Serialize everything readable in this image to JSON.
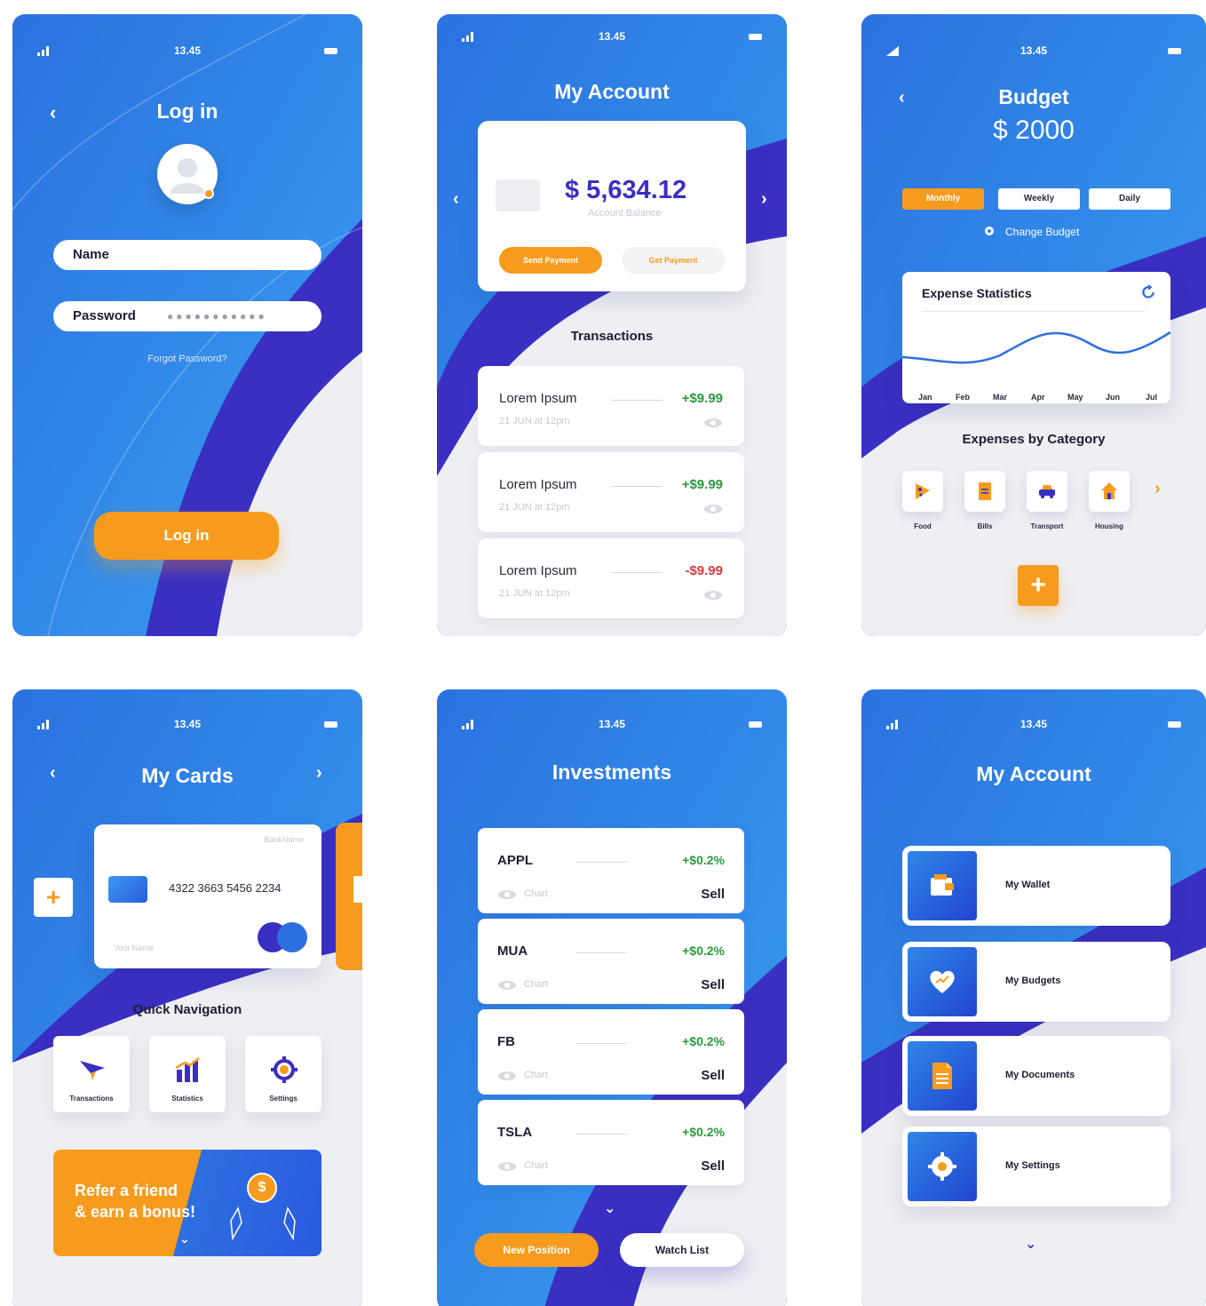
{
  "status": {
    "time": "13.45"
  },
  "colors": {
    "blue": "#2a7de6",
    "navy": "#3a2fc2",
    "orange": "#f79b1e",
    "green": "#2a9a3a",
    "red": "#d83a3a"
  },
  "login": {
    "title": "Log in",
    "name_label": "Name",
    "password_label": "Password",
    "password_mask": "●●●●●●●●●●●",
    "forgot": "Forgot Password?",
    "button": "Log in"
  },
  "account": {
    "title": "My Account",
    "balance": "$ 5,634.12",
    "balance_label": "Account Balance",
    "send": "Send Payment",
    "get": "Get Payment",
    "transactions_title": "Transactions",
    "transactions": [
      {
        "name": "Lorem Ipsum",
        "date": "21 JUN at 12pm",
        "amount": "+$9.99",
        "sign": "pos"
      },
      {
        "name": "Lorem Ipsum",
        "date": "21 JUN at 12pm",
        "amount": "+$9.99",
        "sign": "pos"
      },
      {
        "name": "Lorem Ipsum",
        "date": "21 JUN at 12pm",
        "amount": "-$9.99",
        "sign": "neg"
      }
    ]
  },
  "budget": {
    "title": "Budget",
    "amount": "$ 2000",
    "tabs": [
      "Monthly",
      "Weekly",
      "Daily"
    ],
    "active_tab": "Monthly",
    "change": "Change Budget",
    "stats_title": "Expense Statistics",
    "months": [
      "Jan",
      "Feb",
      "Mar",
      "Apr",
      "May",
      "Jun",
      "Jul"
    ],
    "categories_title": "Expenses by Category",
    "categories": [
      {
        "label": "Food",
        "icon": "pizza-icon"
      },
      {
        "label": "Bills",
        "icon": "document-icon"
      },
      {
        "label": "Transport",
        "icon": "car-icon"
      },
      {
        "label": "Housing",
        "icon": "house-icon"
      }
    ]
  },
  "cards": {
    "title": "My Cards",
    "bank_name": "BankName",
    "number": "4322 3663 5456 2234",
    "holder": "Your Name",
    "quick_nav_title": "Quick Navigation",
    "quick_nav": [
      {
        "label": "Transactions",
        "icon": "paper-plane-icon"
      },
      {
        "label": "Statistics",
        "icon": "bar-chart-icon"
      },
      {
        "label": "Settings",
        "icon": "gear-icon"
      }
    ],
    "refer_line1": "Refer a friend",
    "refer_line2": "& earn a bonus!",
    "coin": "$"
  },
  "investments": {
    "title": "Investments",
    "chart_label": "Chart",
    "sell_label": "Sell",
    "items": [
      {
        "ticker": "APPL",
        "change": "+$0.2%"
      },
      {
        "ticker": "MUA",
        "change": "+$0.2%"
      },
      {
        "ticker": "FB",
        "change": "+$0.2%"
      },
      {
        "ticker": "TSLA",
        "change": "+$0.2%"
      }
    ],
    "new_position": "New Position",
    "watch_list": "Watch List"
  },
  "account_menu": {
    "title": "My Account",
    "items": [
      {
        "label": "My Wallet",
        "icon": "wallet-icon"
      },
      {
        "label": "My Budgets",
        "icon": "heart-chart-icon"
      },
      {
        "label": "My Documents",
        "icon": "document-icon"
      },
      {
        "label": "My Settings",
        "icon": "gear-icon"
      }
    ]
  }
}
